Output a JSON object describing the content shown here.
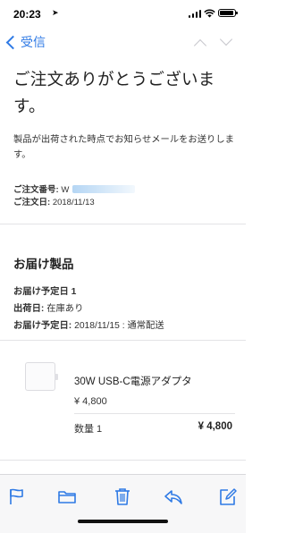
{
  "status_bar": {
    "time": "20:23"
  },
  "nav": {
    "back_label": "受信"
  },
  "email": {
    "headline": "ご注文ありがとうございます。",
    "intro": "製品が出荷された時点でお知らせメールをお送りします。",
    "order_number_label": "ご注文番号:",
    "order_number_value": "W",
    "order_date_label": "ご注文日:",
    "order_date_value": "2018/11/13",
    "section_title": "お届け製品",
    "delivery_group": "お届け予定日 1",
    "ship_label": "出荷日:",
    "ship_value": "在庫あり",
    "eta_label": "お届け予定日:",
    "eta_value": "2018/11/15 : 通常配送"
  },
  "product": {
    "name": "30W USB-C電源アダプタ",
    "price": "¥ 4,800",
    "quantity": "数量 1",
    "total": "¥ 4,800"
  },
  "toolbar": {
    "icons": [
      "flag-icon",
      "folder-icon",
      "trash-icon",
      "reply-icon",
      "compose-icon"
    ]
  },
  "colors": {
    "accent": "#2f7ae5",
    "disabled": "#c6c6cc",
    "toolbar_bg": "#f7f7f8"
  }
}
